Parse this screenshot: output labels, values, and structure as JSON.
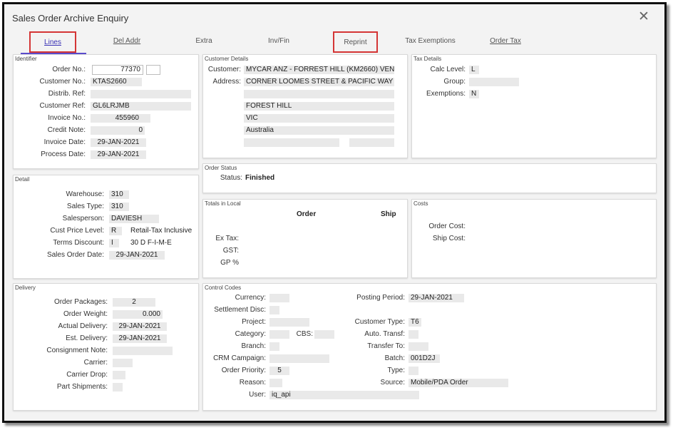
{
  "window": {
    "title": "Sales Order Archive Enquiry"
  },
  "tabs": {
    "lines": "Lines",
    "del_addr": "Del Addr",
    "extra": "Extra",
    "inv_fin": "Inv/Fin",
    "reprint": "Reprint",
    "tax_exemptions": "Tax Exemptions",
    "order_tax": "Order Tax"
  },
  "identifier": {
    "title": "Identifier",
    "order_no_label": "Order No.:",
    "order_no": "77370",
    "order_suffix": "",
    "customer_no_label": "Customer No.:",
    "customer_no": "KTAS2660",
    "distrib_ref_label": "Distrib. Ref:",
    "distrib_ref": "",
    "customer_ref_label": "Customer Ref:",
    "customer_ref": "GL6LRJMB",
    "invoice_no_label": "Invoice No.:",
    "invoice_no": "455960",
    "credit_note_label": "Credit Note:",
    "credit_note": "0",
    "invoice_date_label": "Invoice Date:",
    "invoice_date": "29-JAN-2021",
    "process_date_label": "Process Date:",
    "process_date": "29-JAN-2021"
  },
  "customer_details": {
    "title": "Customer Details",
    "customer_label": "Customer:",
    "customer": "MYCAR ANZ - FORREST HILL (KM2660)  VEN...",
    "address_label": "Address:",
    "address_1": "CORNER LOOMES STREET & PACIFIC WAY",
    "address_2": "",
    "address_3": "FOREST HILL",
    "address_4": "VIC",
    "address_5": "Australia",
    "address_6": "",
    "postcode": ""
  },
  "tax_details": {
    "title": "Tax Details",
    "calc_level_label": "Calc Level:",
    "calc_level": "L",
    "group_label": "Group:",
    "group": "",
    "exemptions_label": "Exemptions:",
    "exemptions": "N"
  },
  "order_status": {
    "title": "Order Status",
    "status_label": "Status:",
    "status": "Finished"
  },
  "detail": {
    "title": "Detail",
    "warehouse_label": "Warehouse:",
    "warehouse": "310",
    "sales_type_label": "Sales Type:",
    "sales_type": "310",
    "salesperson_label": "Salesperson:",
    "salesperson": "DAVIESH",
    "cust_price_level_label": "Cust Price Level:",
    "cust_price_level": "R",
    "cust_price_level_desc": "Retail-Tax Inclusive",
    "terms_discount_label": "Terms Discount:",
    "terms_discount": "I",
    "terms_discount_desc": "30 D F-I-M-E",
    "sales_order_date_label": "Sales Order Date:",
    "sales_order_date": "29-JAN-2021"
  },
  "totals_local": {
    "title": "Totals in Local",
    "order_header": "Order",
    "ship_header": "Ship",
    "ex_tax_label": "Ex Tax:",
    "gst_label": "GST:",
    "gp_label": "GP %"
  },
  "costs": {
    "title": "Costs",
    "order_cost_label": "Order Cost:",
    "ship_cost_label": "Ship Cost:"
  },
  "delivery": {
    "title": "Delivery",
    "order_packages_label": "Order Packages:",
    "order_packages": "2",
    "order_weight_label": "Order Weight:",
    "order_weight": "0.000",
    "actual_delivery_label": "Actual Delivery:",
    "actual_delivery": "29-JAN-2021",
    "est_delivery_label": "Est. Delivery:",
    "est_delivery": "29-JAN-2021",
    "consignment_note_label": "Consignment Note:",
    "consignment_note": "",
    "carrier_label": "Carrier:",
    "carrier": "",
    "carrier_drop_label": "Carrier Drop:",
    "carrier_drop": "",
    "part_shipments_label": "Part Shipments:",
    "part_shipments": ""
  },
  "control_codes": {
    "title": "Control Codes",
    "currency_label": "Currency:",
    "currency": "",
    "settlement_disc_label": "Settlement Disc:",
    "settlement_disc": "",
    "project_label": "Project:",
    "project": "",
    "category_label": "Category:",
    "category": "",
    "cbs_label": "CBS:",
    "cbs": "",
    "branch_label": "Branch:",
    "branch": "",
    "crm_campaign_label": "CRM Campaign:",
    "crm_campaign": "",
    "order_priority_label": "Order Priority:",
    "order_priority": "5",
    "reason_label": "Reason:",
    "reason": "",
    "user_label": "User:",
    "user": "iq_api",
    "posting_period_label": "Posting Period:",
    "posting_period": "29-JAN-2021",
    "customer_type_label": "Customer Type:",
    "customer_type": "T6",
    "auto_transf_label": "Auto. Transf:",
    "auto_transf": "",
    "transfer_to_label": "Transfer To:",
    "transfer_to": "",
    "batch_label": "Batch:",
    "batch": "001D2J",
    "type_label": "Type:",
    "type": "",
    "source_label": "Source:",
    "source": "Mobile/PDA Order"
  }
}
